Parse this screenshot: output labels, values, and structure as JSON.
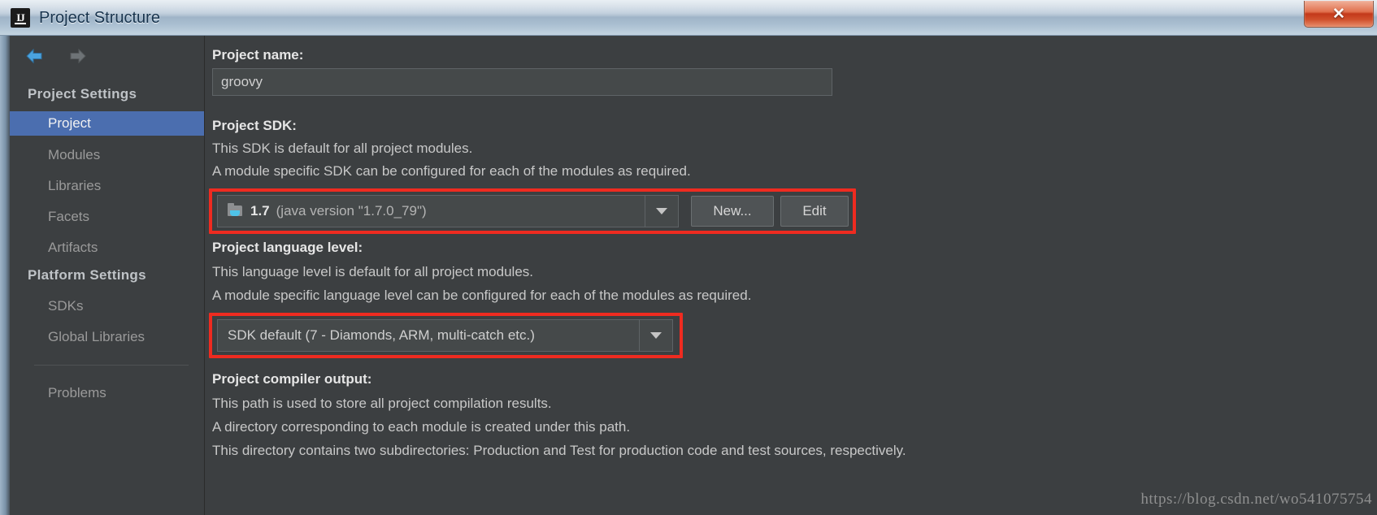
{
  "window": {
    "title": "Project Structure",
    "app_icon": "intellij-idea-icon",
    "close_label": "✕"
  },
  "sidebar": {
    "back_icon": "back-arrow-icon",
    "forward_icon": "forward-arrow-icon",
    "groups": [
      {
        "header": "Project Settings",
        "items": [
          {
            "label": "Project",
            "selected": true
          },
          {
            "label": "Modules",
            "selected": false
          },
          {
            "label": "Libraries",
            "selected": false
          },
          {
            "label": "Facets",
            "selected": false
          },
          {
            "label": "Artifacts",
            "selected": false
          }
        ]
      },
      {
        "header": "Platform Settings",
        "items": [
          {
            "label": "SDKs",
            "selected": false
          },
          {
            "label": "Global Libraries",
            "selected": false
          }
        ]
      }
    ],
    "problems": {
      "label": "Problems"
    }
  },
  "main": {
    "project_name": {
      "label": "Project name:",
      "value": "groovy"
    },
    "project_sdk": {
      "label": "Project SDK:",
      "description_lines": [
        "This SDK is default for all project modules.",
        "A module specific SDK can be configured for each of the modules as required."
      ],
      "selected_name": "1.7",
      "selected_detail": "(java version \"1.7.0_79\")",
      "icon": "sdk-folder-java-icon",
      "dropdown_icon": "chevron-down-icon",
      "new_button": "New...",
      "edit_button": "Edit"
    },
    "language_level": {
      "label": "Project language level:",
      "description_lines": [
        "This language level is default for all project modules.",
        "A module specific language level can be configured for each of the modules as required."
      ],
      "selected": "SDK default (7 - Diamonds, ARM, multi-catch etc.)",
      "dropdown_icon": "chevron-down-icon"
    },
    "compiler_output": {
      "label": "Project compiler output:",
      "description_lines": [
        "This path is used to store all project compilation results.",
        "A directory corresponding to each module is created under this path.",
        "This directory contains two subdirectories: Production and Test for production code and test sources, respectively."
      ]
    }
  },
  "annotations": {
    "color": "#ef2b20",
    "highlights": [
      {
        "name": "project-sdk-row-highlight"
      },
      {
        "name": "language-level-row-highlight"
      }
    ]
  },
  "watermark": {
    "text": "https://blog.csdn.net/wo541075754"
  }
}
